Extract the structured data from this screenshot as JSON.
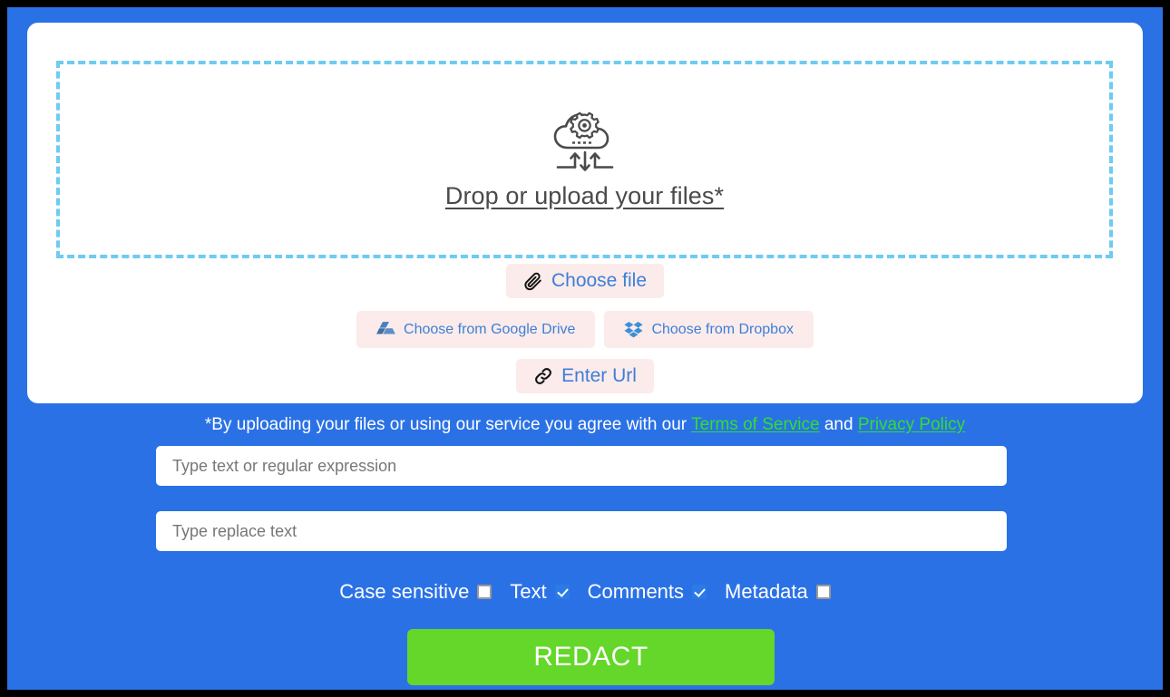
{
  "theme": {
    "page_background": "#2b71e6",
    "card_background": "#ffffff",
    "dropzone_border": "#6ecbf2",
    "source_button_background": "#fbebeb",
    "source_button_text": "#3d7fd6",
    "link_green": "#2ee02e",
    "submit_green": "#64d72a",
    "checkbox_checked": "#2b7ae5"
  },
  "dropzone": {
    "icon": "cloud-upload-gear-icon",
    "label": "Drop or upload your files*"
  },
  "sources": {
    "choose_file": {
      "label": "Choose file",
      "icon": "paperclip-icon"
    },
    "google_drive": {
      "label": "Choose from Google Drive",
      "icon": "google-drive-icon"
    },
    "dropbox": {
      "label": "Choose from Dropbox",
      "icon": "dropbox-icon"
    },
    "enter_url": {
      "label": "Enter Url",
      "icon": "link-icon"
    }
  },
  "disclaimer": {
    "prefix": "*By uploading your files or using our service you agree with our ",
    "terms_link": "Terms of Service",
    "conjunction": " and ",
    "privacy_link": "Privacy Policy"
  },
  "fields": {
    "find": {
      "placeholder": "Type text or regular expression",
      "value": ""
    },
    "replace": {
      "placeholder": "Type replace text",
      "value": ""
    }
  },
  "options": [
    {
      "label": "Case sensitive",
      "checked": false
    },
    {
      "label": "Text",
      "checked": true
    },
    {
      "label": "Comments",
      "checked": true
    },
    {
      "label": "Metadata",
      "checked": false
    }
  ],
  "submit": {
    "label": "REDACT"
  }
}
